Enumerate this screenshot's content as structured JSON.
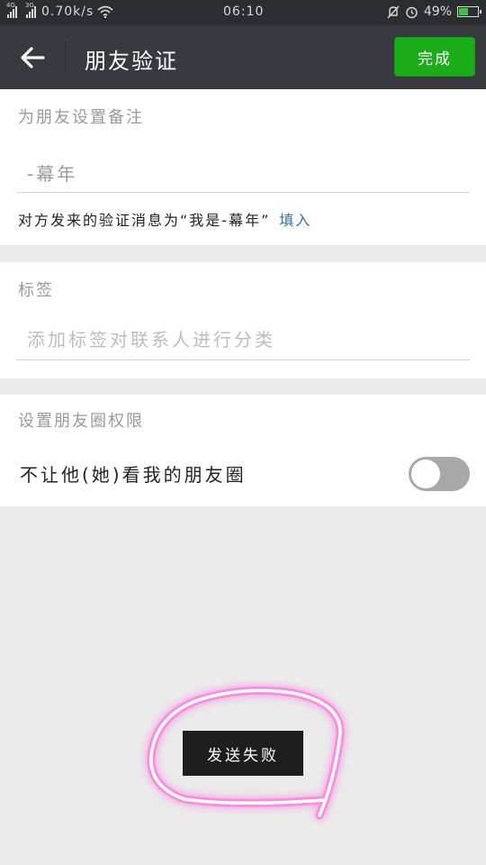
{
  "status_bar": {
    "net_a": "4G",
    "net_b": "3G",
    "speed": "0.70k/s",
    "time": "06:10",
    "battery": "49%",
    "battery_level": 0.49
  },
  "header": {
    "title": "朋友验证",
    "done_label": "完成"
  },
  "remark_section": {
    "label": "为朋友设置备注",
    "value": "-幕年",
    "note": "对方发来的验证消息为“我是-幕年”",
    "fill_link": "填入"
  },
  "tag_section": {
    "label": "标签",
    "placeholder": "添加标签对联系人进行分类"
  },
  "moments_section": {
    "label": "设置朋友圈权限",
    "toggle_label": "不让他(她)看我的朋友圈",
    "toggle_on": false
  },
  "toast": {
    "text": "发送失败"
  },
  "colors": {
    "accent_green": "#1aad19",
    "link_blue": "#3a6ea8",
    "titlebar": "#393a3f",
    "highlight_pink": "#ff66dd"
  }
}
